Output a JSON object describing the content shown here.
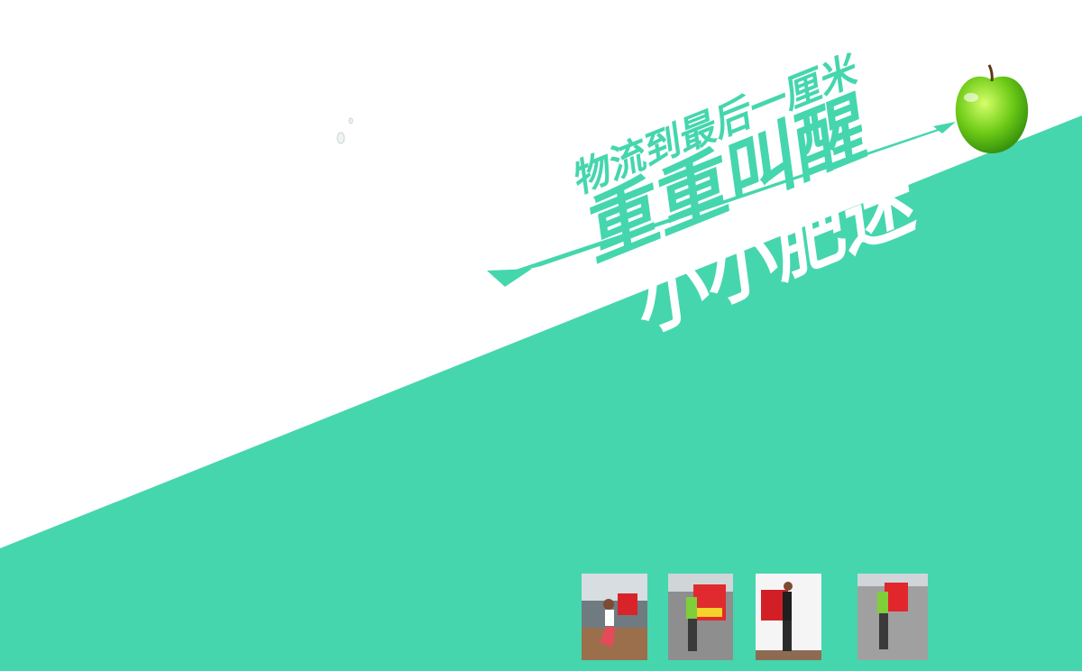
{
  "background": {
    "top_color": "#ffffff",
    "band_color": "#45d6ae"
  },
  "slogan": {
    "line1": "物流到最后一厘米",
    "line2": "重重叫醒",
    "line3": "小小肥迷",
    "text_color": "#45d6ae"
  },
  "decorations": {
    "apple_icon": "green-apple",
    "arrow_icon": "arrow",
    "droplet_icon": "water-droplets"
  },
  "thumbnails": [
    {
      "scene": "indoor-office",
      "subject_pose": "kneeling-with-backpack",
      "bag_color": "#d8232a"
    },
    {
      "scene": "outdoor-paving",
      "subject_pose": "walking-back-view",
      "bag_color": "#e02a2f"
    },
    {
      "scene": "indoor-wall",
      "subject_pose": "standing-side-view",
      "bag_color": "#d21f26"
    },
    {
      "scene": "outdoor-paving",
      "subject_pose": "walking-side-view",
      "bag_color": "#e1262c"
    }
  ]
}
